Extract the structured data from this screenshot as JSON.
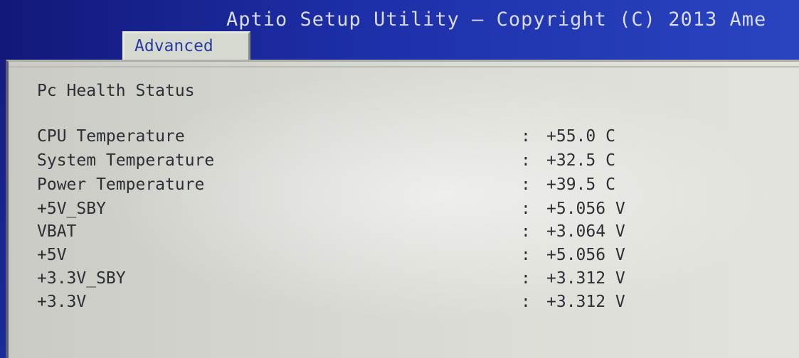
{
  "header": {
    "title": "Aptio Setup Utility – Copyright (C) 2013 Ame",
    "active_tab": "Advanced"
  },
  "section": {
    "title": "Pc Health Status"
  },
  "readings": [
    {
      "label": "CPU Temperature",
      "value": "+55.0 C"
    },
    {
      "label": "System Temperature",
      "value": "+32.5 C"
    },
    {
      "label": "Power Temperature",
      "value": "+39.5 C"
    },
    {
      "label": "+5V_SBY",
      "value": "+5.056 V"
    },
    {
      "label": "VBAT",
      "value": "+3.064 V"
    },
    {
      "label": "+5V",
      "value": "+5.056 V"
    },
    {
      "label": "+3.3V_SBY",
      "value": "+3.312 V"
    },
    {
      "label": "+3.3V",
      "value": "+3.312 V"
    }
  ],
  "separator": ":",
  "colors": {
    "title_bar": "#1d2fa8",
    "tab": "#d6d9cf",
    "tab_text": "#2a3aa4",
    "panel": "#d6d7d1",
    "text": "#2c2f34"
  }
}
